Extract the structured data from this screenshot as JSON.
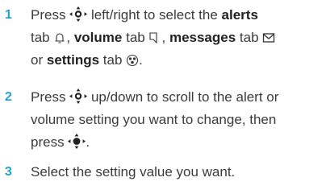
{
  "steps": [
    {
      "number": "1",
      "parts": {
        "a": "Press",
        "b": "left/right to select the",
        "alerts": "alerts",
        "c": "tab",
        "volume": "volume",
        "d": "tab",
        "messages": "messages",
        "e": "tab",
        "f": "or",
        "settings": "settings",
        "g": "tab",
        "h": "."
      }
    },
    {
      "number": "2",
      "parts": {
        "a": "Press",
        "b": "up/down to scroll to the alert or",
        "line2": "volume setting you want to change, then",
        "c": "press",
        "d": "."
      }
    },
    {
      "number": "3",
      "parts": {
        "a": "Select the setting value you want."
      }
    }
  ],
  "icons": {
    "nav_key": "nav-key-icon",
    "center_select": "center-select-icon",
    "alerts_tab": "bell-icon",
    "volume_tab": "speaker-icon",
    "messages_tab": "envelope-icon",
    "settings_tab": "settings-icon"
  },
  "colors": {
    "step_number": "#1fa3d6",
    "text": "#3b3b3b"
  }
}
